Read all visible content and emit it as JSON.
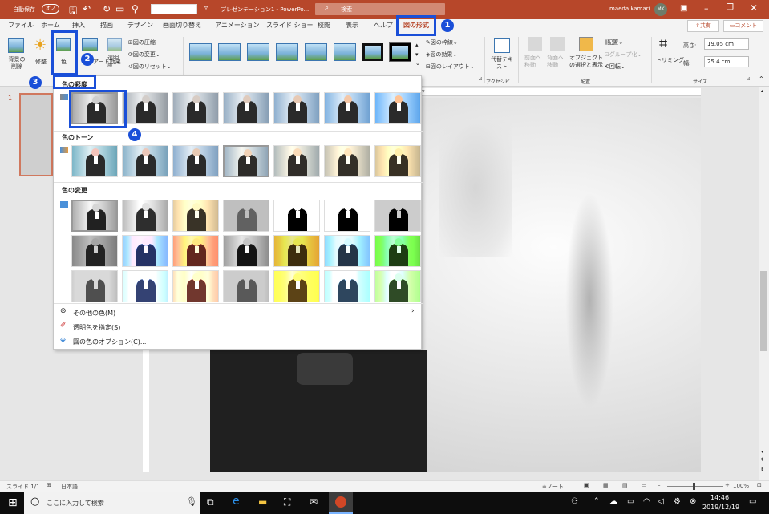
{
  "titlebar": {
    "autosave_label": "自動保存",
    "autosave_state": "オフ",
    "title": "プレゼンテーション1 - PowerPo...",
    "search_placeholder": "検索",
    "user_name": "maeda kamari",
    "user_initials": "MK"
  },
  "tabs": [
    "ファイル",
    "ホーム",
    "挿入",
    "描画",
    "デザイン",
    "画面切り替え",
    "アニメーション",
    "スライド ショー",
    "校閲",
    "表示",
    "ヘルプ",
    "図の形式"
  ],
  "share_label": "共有",
  "comment_label": "コメント",
  "ribbon": {
    "remove_bg": "背景の削除",
    "corrections": "修整",
    "color": "色",
    "artistic": "アート効果",
    "transparency": "透明度",
    "compress": "図の圧縮",
    "change": "図の変更",
    "reset": "図のリセット",
    "border": "図の枠線",
    "effects": "図の効果",
    "layout": "図のレイアウト",
    "alt_text": "代替テキスト",
    "accessibility": "アクセシビ...",
    "bring_forward": "前面へ移動",
    "send_backward": "背面へ移動",
    "selection_pane": "オブジェクトの選択と表示",
    "align": "配置",
    "group": "グループ化",
    "rotate": "回転",
    "arrange": "配置",
    "crop": "トリミング",
    "height_label": "高さ:",
    "height_value": "19.05 cm",
    "width_label": "幅:",
    "width_value": "25.4 cm",
    "size": "サイズ"
  },
  "gallery": {
    "saturation": "色の彩度",
    "tone": "色のトーン",
    "recolor": "色の変更",
    "more_colors": "その他の色(M)",
    "set_transparent": "透明色を指定(S)",
    "color_options": "図の色のオプション(C)..."
  },
  "callouts": [
    "1",
    "2",
    "3",
    "4"
  ],
  "slide_number": "1",
  "status": {
    "slide": "スライド 1/1",
    "language": "日本語",
    "notes": "ノート",
    "zoom": "100%"
  },
  "taskbar": {
    "search_placeholder": "ここに入力して検索",
    "time": "14:46",
    "date": "2019/12/19"
  }
}
